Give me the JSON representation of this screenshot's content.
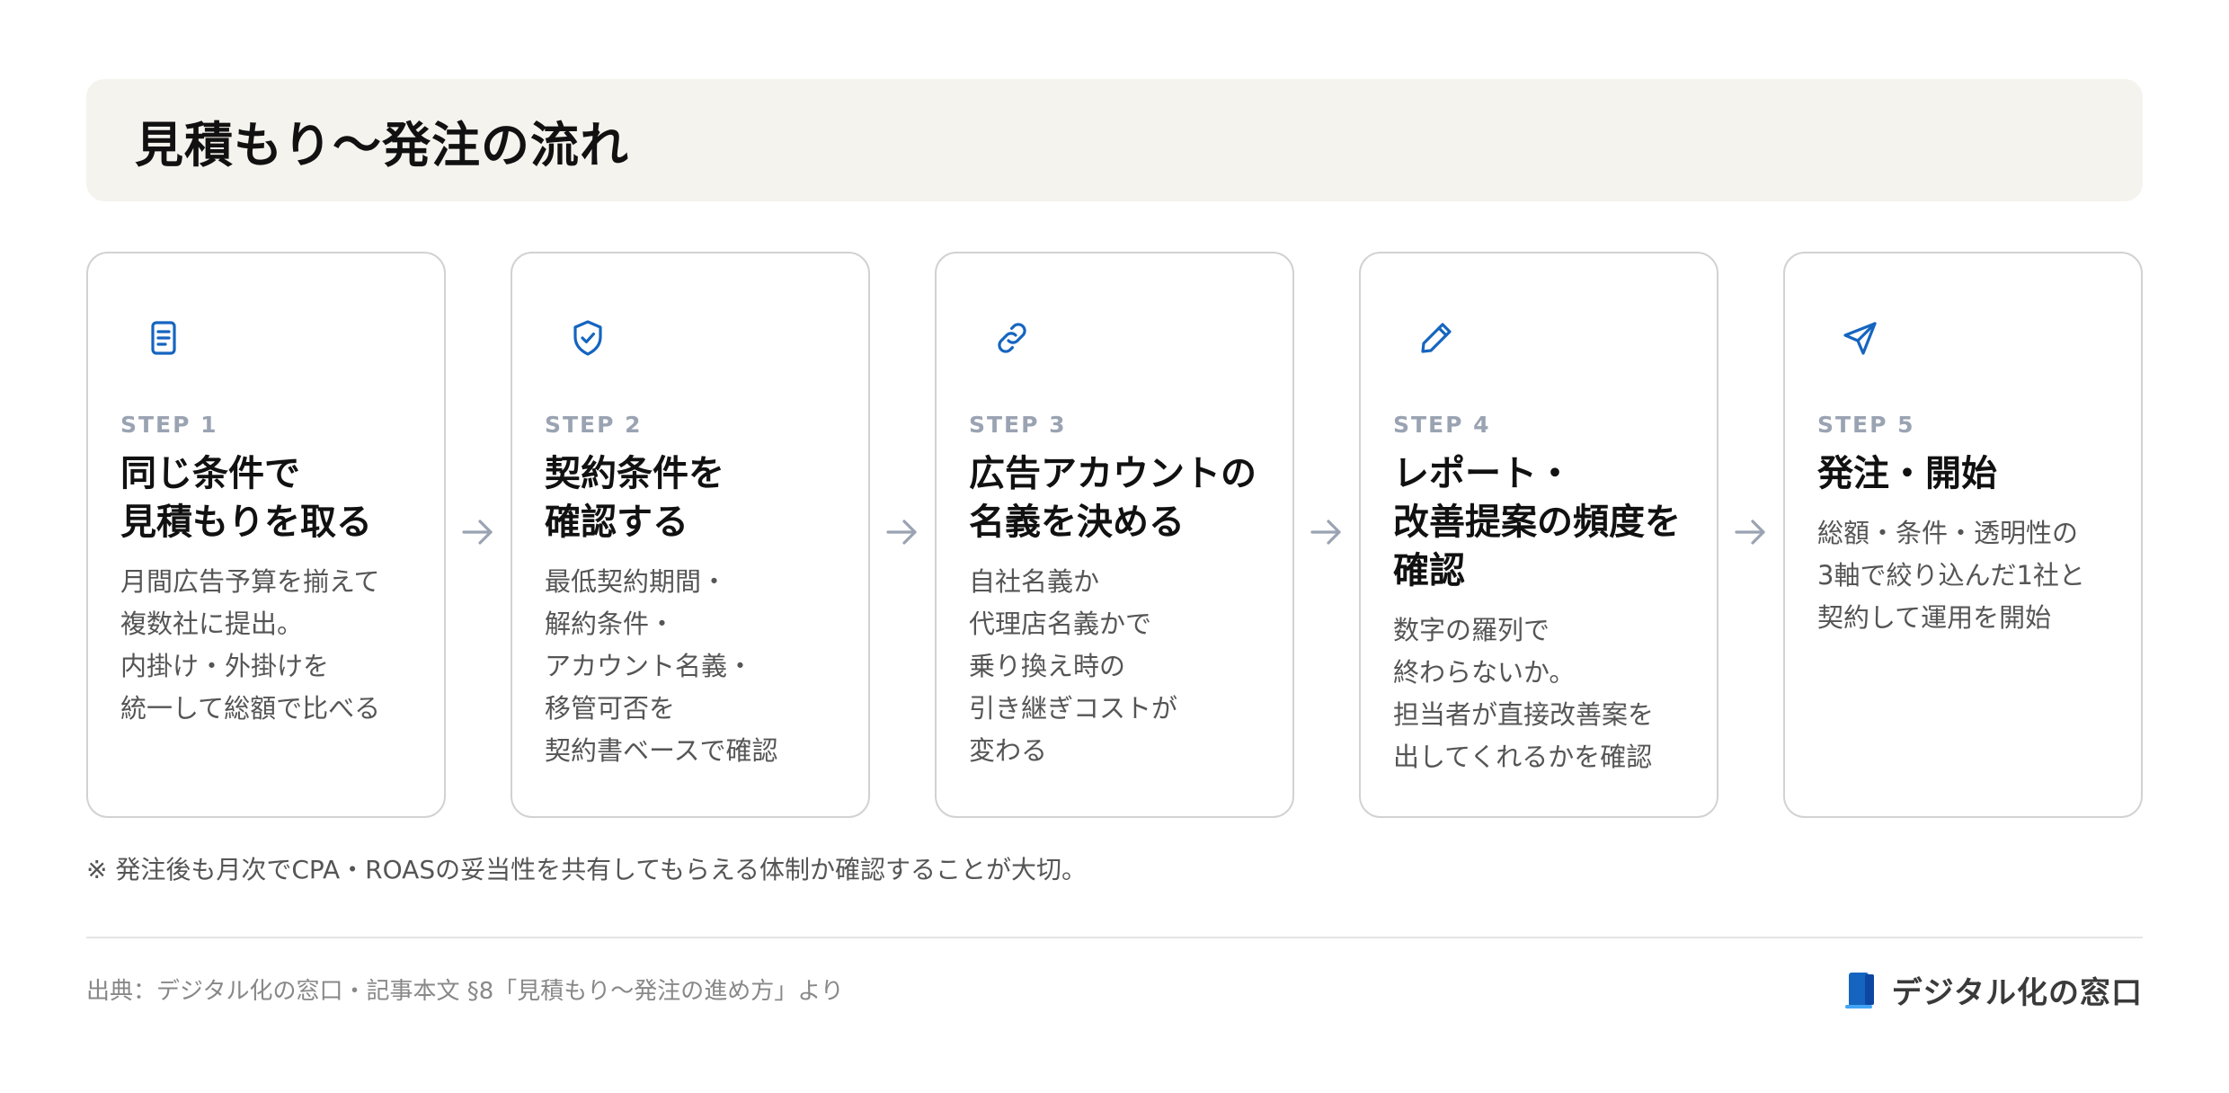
{
  "header": {
    "title": "見積もり〜発注の流れ"
  },
  "steps": [
    {
      "icon": "document-icon",
      "step_label": "STEP 1",
      "title_lines": [
        "同じ条件で",
        "見積もりを取る"
      ],
      "desc_lines": [
        "月間広告予算を揃えて",
        "複数社に提出。",
        "内掛け・外掛けを",
        "統一して総額で比べる"
      ]
    },
    {
      "icon": "shield-check-icon",
      "step_label": "STEP 2",
      "title_lines": [
        "契約条件を",
        "確認する"
      ],
      "desc_lines": [
        "最低契約期間・",
        "解約条件・",
        "アカウント名義・",
        "移管可否を",
        "契約書ベースで確認"
      ]
    },
    {
      "icon": "link-icon",
      "step_label": "STEP 3",
      "title_lines": [
        "広告アカウントの",
        "名義を決める"
      ],
      "desc_lines": [
        "自社名義か",
        "代理店名義かで",
        "乗り換え時の",
        "引き継ぎコストが",
        "変わる"
      ]
    },
    {
      "icon": "pencil-icon",
      "step_label": "STEP 4",
      "title_lines": [
        "レポート・",
        "改善提案の頻度を",
        "確認"
      ],
      "desc_lines": [
        "数字の羅列で",
        "終わらないか。",
        "担当者が直接改善案を",
        "出してくれるかを確認"
      ]
    },
    {
      "icon": "send-icon",
      "step_label": "STEP 5",
      "title_lines": [
        "発注・開始"
      ],
      "desc_lines": [
        "総額・条件・透明性の",
        "3軸で絞り込んだ1社と",
        "契約して運用を開始"
      ]
    }
  ],
  "note": "※ 発注後も月次でCPA・ROASの妥当性を共有してもらえる体制か確認することが大切。",
  "source": "出典：デジタル化の窓口・記事本文 §8「見積もり〜発注の進め方」より",
  "logo": {
    "text": "デジタル化の窓口",
    "icon": "logo-icon"
  },
  "colors": {
    "accent": "#1565c0",
    "step_label": "#9aa3b2",
    "arrow": "#9aa3b2",
    "header_bg": "#f5f3ee"
  }
}
